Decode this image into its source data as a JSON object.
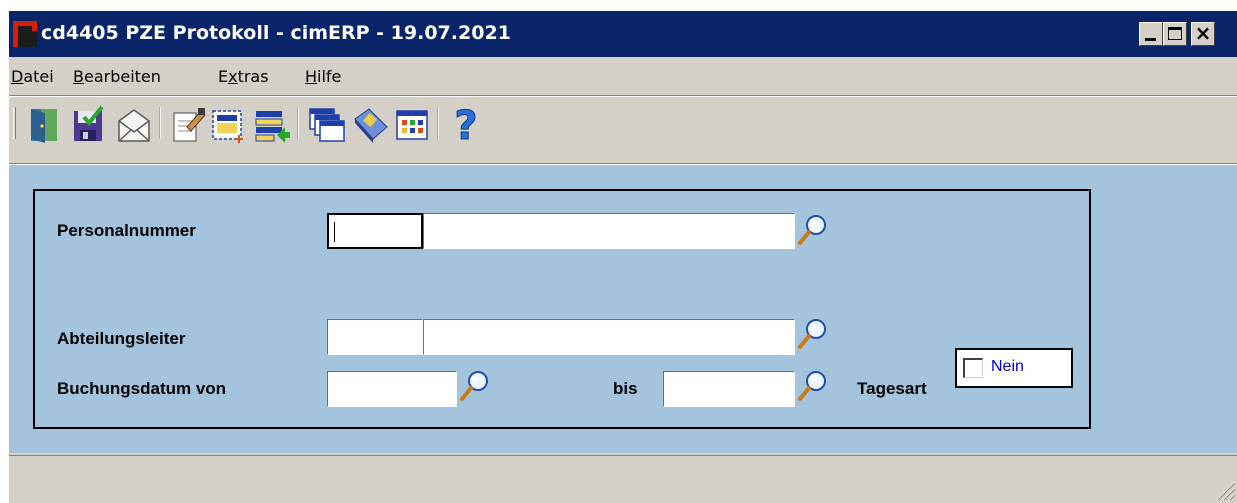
{
  "window": {
    "title": "cd4405 PZE Protokoll - cimERP - 19.07.2021",
    "buttons": {
      "minimize": "minimize",
      "maximize": "maximize",
      "close": "×"
    }
  },
  "menu": {
    "items": [
      {
        "label": "Datei",
        "mnemonic": "D"
      },
      {
        "label": "Bearbeiten",
        "mnemonic": "B"
      },
      {
        "label": "Extras",
        "mnemonic": "x"
      },
      {
        "label": "Hilfe",
        "mnemonic": "H"
      }
    ]
  },
  "toolbar": {
    "buttons": [
      {
        "icon": "exit-door-icon"
      },
      {
        "icon": "save-disk-icon"
      },
      {
        "icon": "mail-envelope-icon"
      },
      {
        "icon": "edit-notepad-icon"
      },
      {
        "icon": "new-record-icon"
      },
      {
        "icon": "transfer-import-icon"
      },
      {
        "icon": "windows-stack-icon"
      },
      {
        "icon": "book-tag-icon"
      },
      {
        "icon": "table-grid-icon"
      },
      {
        "icon": "help-question-icon"
      }
    ]
  },
  "form": {
    "personalnummer": {
      "label": "Personalnummer",
      "code": "",
      "name": ""
    },
    "abteilungsleiter": {
      "label": "Abteilungsleiter",
      "code": "",
      "name": ""
    },
    "buchungsdatum_von": {
      "label": "Buchungsdatum von",
      "value": ""
    },
    "bis": {
      "label": "bis",
      "value": ""
    },
    "tagesart": {
      "label": "Tagesart",
      "checked": false,
      "check_label": "Nein"
    }
  },
  "colors": {
    "title_bar": "#0a246a",
    "client_background": "#a3c4dc",
    "window_face": "#d4d0c8",
    "checkbox_text": "#0000c0"
  }
}
